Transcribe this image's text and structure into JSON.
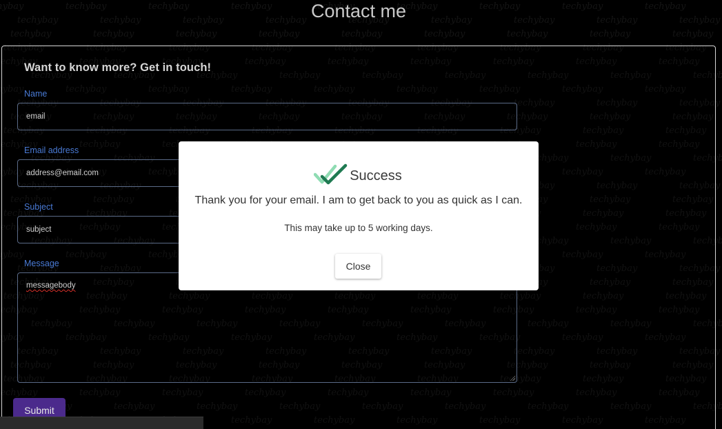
{
  "page": {
    "title": "Contact me",
    "watermark_text": "techybay"
  },
  "form": {
    "heading": "Want to know more? Get in touch!",
    "name_label": "Name",
    "name_value": "email",
    "email_label": "Email address",
    "email_value": "address@email.com",
    "subject_label": "Subject",
    "subject_value": "subject",
    "message_label": "Message",
    "message_value": "messagebody",
    "submit_label": "Submit"
  },
  "modal": {
    "icon": "double-check-icon",
    "title": "Success",
    "message": "Thank you for your email. I am to get back to you as quick as I can.",
    "note": "This may take up to 5 working days.",
    "close_label": "Close"
  },
  "colors": {
    "background": "#000000",
    "label_blue": "#4a7bd6",
    "submit_purple": "#4b2a8c",
    "check_green_light": "#7fd8a8",
    "check_green_dark": "#1f7a52"
  }
}
